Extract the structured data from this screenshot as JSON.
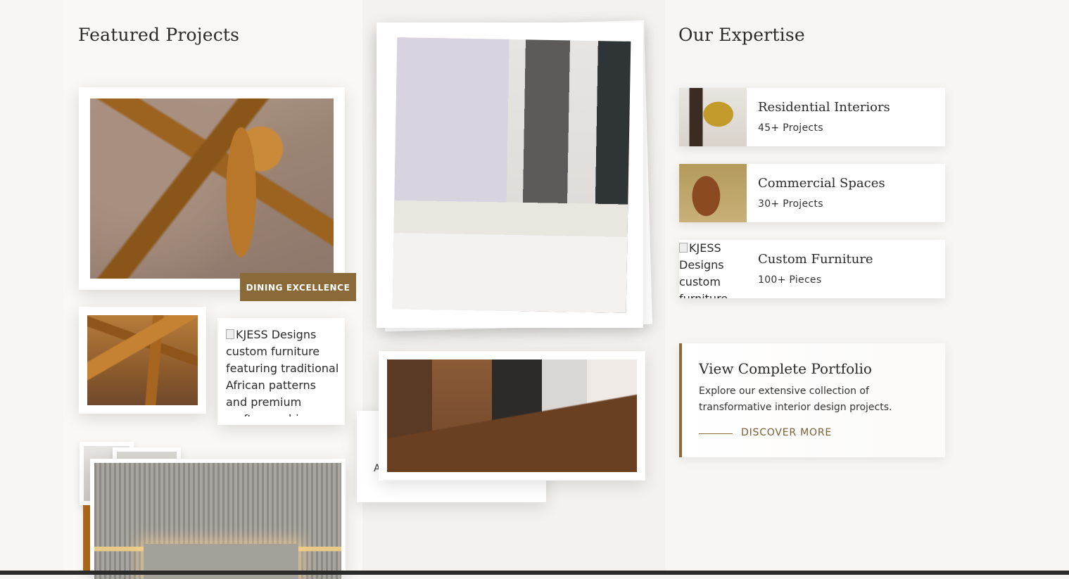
{
  "sections": {
    "featured_title": "Featured Projects",
    "expertise_title": "Our Expertise"
  },
  "featured": {
    "badge": "DINING EXCELLENCE",
    "broken_image_alt": "KJESS Designs custom furniture featuring traditional African patterns and premium craftsmanship",
    "hidden_card_letter": "A"
  },
  "expertise": [
    {
      "title": "Residential Interiors",
      "count": "45+ Projects",
      "thumb": "chair-photo"
    },
    {
      "title": "Commercial Spaces",
      "count": "30+ Projects",
      "thumb": "wood-armrest-photo"
    },
    {
      "title": "Custom Furniture",
      "count": "100+ Pieces",
      "thumb_alt": "KJESS Designs custom furniture"
    }
  ],
  "portfolio": {
    "title": "View Complete Portfolio",
    "description": "Explore our extensive collection of transformative interior design projects.",
    "link": "DISCOVER MORE"
  },
  "colors": {
    "accent": "#8a6a38",
    "background": "#f7f6f4",
    "card": "#ffffff"
  }
}
